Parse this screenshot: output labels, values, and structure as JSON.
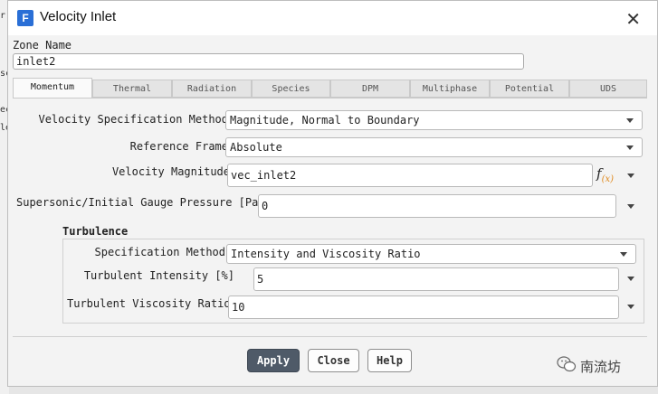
{
  "background": {
    "fragments": [
      "r",
      "sc",
      "ec",
      "le"
    ]
  },
  "dialog": {
    "title": "Velocity Inlet",
    "icon_letter": "F",
    "icon_name": "fluent-app-icon",
    "close_glyph": "✕"
  },
  "zone": {
    "label": "Zone Name",
    "value": "inlet2"
  },
  "tabs": [
    {
      "label": "Momentum",
      "active": true
    },
    {
      "label": "Thermal"
    },
    {
      "label": "Radiation"
    },
    {
      "label": "Species"
    },
    {
      "label": "DPM"
    },
    {
      "label": "Multiphase"
    },
    {
      "label": "Potential"
    },
    {
      "label": "UDS"
    }
  ],
  "momentum": {
    "velocity_spec_label": "Velocity Specification Method",
    "velocity_spec_value": "Magnitude, Normal to Boundary",
    "reference_frame_label": "Reference Frame",
    "reference_frame_value": "Absolute",
    "velocity_magnitude_label": "Velocity Magnitude",
    "velocity_magnitude_value": "vec_inlet2",
    "fx_label": "f",
    "fx_sub": "(x)",
    "pressure_label": "Supersonic/Initial Gauge Pressure [Pa]",
    "pressure_value": "0"
  },
  "turbulence": {
    "heading": "Turbulence",
    "spec_label": "Specification Method",
    "spec_value": "Intensity and Viscosity Ratio",
    "intensity_label": "Turbulent Intensity [%]",
    "intensity_value": "5",
    "viscosity_label": "Turbulent Viscosity Ratio",
    "viscosity_value": "10"
  },
  "buttons": {
    "apply": "Apply",
    "close": "Close",
    "help": "Help"
  },
  "watermark": {
    "text": "南流坊",
    "icon_name": "wechat-icon"
  },
  "colors": {
    "accent": "#2a6fd6",
    "apply_bg": "#4f5a68",
    "fx_orange": "#e08a1e"
  }
}
